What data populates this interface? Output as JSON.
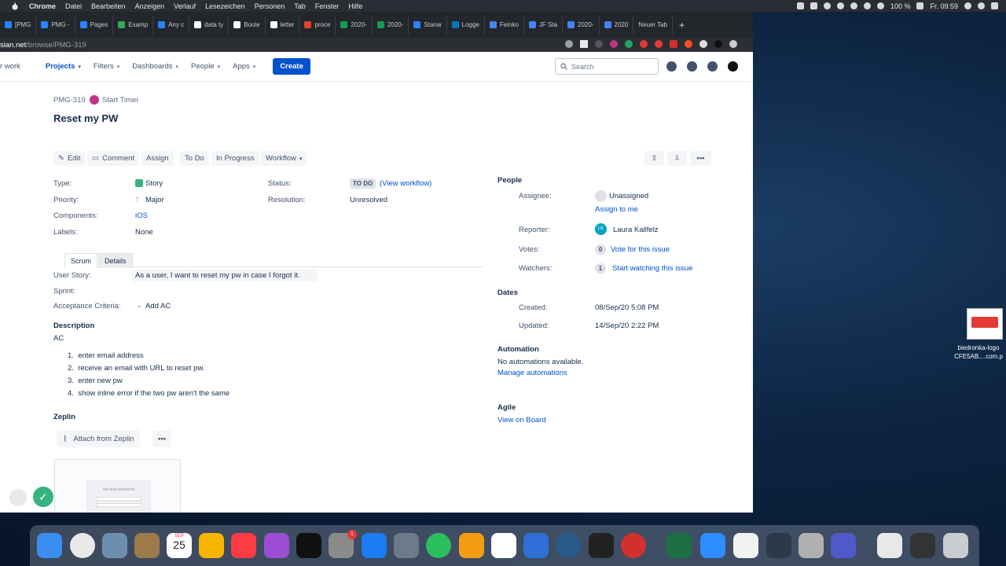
{
  "menubar": {
    "app": "Chrome",
    "menus": [
      "Datei",
      "Bearbeiten",
      "Anzeigen",
      "Verlauf",
      "Lesezeichen",
      "Personen",
      "Tab",
      "Fenster",
      "Hilfe"
    ],
    "battery": "100 %",
    "clock": "Fr. 09:59"
  },
  "tabs": [
    {
      "label": "[PMG",
      "color": "#2684ff"
    },
    {
      "label": "PMG -",
      "color": "#2684ff"
    },
    {
      "label": "Pages",
      "color": "#2684ff"
    },
    {
      "label": "Examp",
      "color": "#34a853"
    },
    {
      "label": "Any c",
      "color": "#2684ff"
    },
    {
      "label": "data ty",
      "color": "#ffffff"
    },
    {
      "label": "Boole",
      "color": "#ffffff"
    },
    {
      "label": "letter",
      "color": "#ffffff"
    },
    {
      "label": "proce",
      "color": "#e2432a"
    },
    {
      "label": "2020-",
      "color": "#0f9d58"
    },
    {
      "label": "2020-",
      "color": "#0f9d58"
    },
    {
      "label": "Stanw",
      "color": "#2684ff"
    },
    {
      "label": "Logge",
      "color": "#0079bf"
    },
    {
      "label": "Feinko",
      "color": "#4285f4"
    },
    {
      "label": "JF Sta",
      "color": "#4285f4"
    },
    {
      "label": "2020-",
      "color": "#4285f4"
    },
    {
      "label": "2020",
      "color": "#4285f4"
    },
    {
      "label": "Neuer Tab",
      "color": ""
    }
  ],
  "url": {
    "host": "sian.net",
    "path": "/browse/PMG-319"
  },
  "jira_nav": {
    "items": [
      {
        "label": "r work",
        "active": false,
        "chevron": false
      },
      {
        "label": "Projects",
        "active": true,
        "chevron": true
      },
      {
        "label": "Filters",
        "active": false,
        "chevron": true
      },
      {
        "label": "Dashboards",
        "active": false,
        "chevron": true
      },
      {
        "label": "People",
        "active": false,
        "chevron": true
      },
      {
        "label": "Apps",
        "active": false,
        "chevron": true
      }
    ],
    "create": "Create",
    "search_placeholder": "Search"
  },
  "issue": {
    "key": "PMG-319",
    "start_timer": "Start Timer",
    "title": "Reset my PW",
    "actions": {
      "edit": "Edit",
      "comment": "Comment",
      "assign": "Assign",
      "todo": "To Do",
      "in_progress": "In Progress",
      "workflow": "Workflow"
    },
    "fields": {
      "type_label": "Type:",
      "type_value": "Story",
      "priority_label": "Priority:",
      "priority_value": "Major",
      "components_label": "Components:",
      "components_value": "iOS",
      "labels_label": "Labels:",
      "labels_value": "None",
      "status_label": "Status:",
      "status_value": "TO DO",
      "view_workflow": "(View workflow)",
      "resolution_label": "Resolution:",
      "resolution_value": "Unresolved"
    },
    "panel_tabs": {
      "scrum": "Scrum",
      "details": "Details"
    },
    "scrum": {
      "user_story_label": "User Story:",
      "user_story_value": "As a user, I want to reset my pw in case I forgot it.",
      "sprint_label": "Sprint:",
      "ac_label": "Acceptance Criteria:",
      "ac_value": "Add AC"
    },
    "description": {
      "heading": "Description",
      "intro": "AC",
      "items": [
        "enter email address",
        "receive an email with URL to reset pw.",
        "enter new pw",
        "show inline error if the two pw aren't the same"
      ]
    },
    "zeplin": {
      "heading": "Zeplin",
      "attach": "Attach from Zeplin",
      "thumb_title": "Set new password"
    }
  },
  "sidebar": {
    "people": {
      "heading": "People",
      "assignee_label": "Assignee:",
      "assignee_value": "Unassigned",
      "assign_to_me": "Assign to me",
      "reporter_label": "Reporter:",
      "reporter_value": "Laura Kallfelz",
      "reporter_initials": "LK",
      "votes_label": "Votes:",
      "votes_count": "0",
      "votes_link": "Vote for this issue",
      "watchers_label": "Watchers:",
      "watchers_count": "1",
      "watchers_link": "Start watching this issue"
    },
    "dates": {
      "heading": "Dates",
      "created_label": "Created:",
      "created_value": "08/Sep/20 5:08 PM",
      "updated_label": "Updated:",
      "updated_value": "14/Sep/20 2:22 PM"
    },
    "automation": {
      "heading": "Automation",
      "text": "No automations available.",
      "link": "Manage automations"
    },
    "agile": {
      "heading": "Agile",
      "link": "View on Board"
    }
  },
  "desktop_file": {
    "label_1": "biedronka-logo",
    "label_2": "CFE5AB....com.p"
  },
  "dock": {
    "calendar_month": "SEP",
    "calendar_day": "25",
    "badge": "1"
  }
}
